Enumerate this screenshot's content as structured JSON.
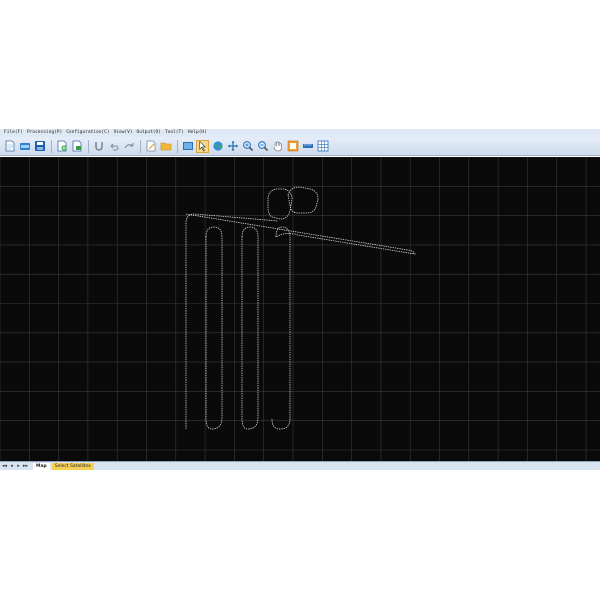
{
  "menu": [
    "File(F)",
    "Processing(P)",
    "Configuration(C)",
    "View(V)",
    "Output(O)",
    "Tool(T)",
    "Help(H)"
  ],
  "toolbar_icons": [
    "new-file-icon",
    "open-icon",
    "save-icon",
    "add-file-icon",
    "export-icon",
    "sep",
    "magnet-icon",
    "undo-icon",
    "redo-icon",
    "sep",
    "edit-icon",
    "folder-icon",
    "sep",
    "map-view-icon",
    "pointer-icon",
    "globe-icon",
    "move-icon",
    "zoom-in-icon",
    "zoom-out-icon",
    "pan-hand-icon",
    "fit-icon",
    "ruler-icon",
    "grid-icon"
  ],
  "tabs": {
    "nav": [
      "◂◂",
      "◂",
      "▸",
      "▸▸"
    ],
    "map": "Map",
    "satellites": "Select Satellites"
  },
  "colors": {
    "canvas_bg": "#0a0a0a",
    "grid": "#3a3a3a",
    "track": "#d8d8d8",
    "tab_highlight": "#f6cf55"
  }
}
